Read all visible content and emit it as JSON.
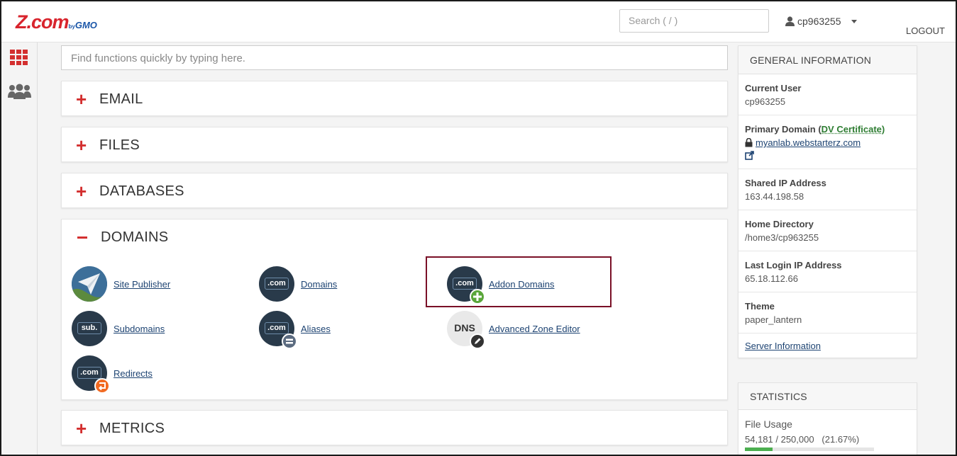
{
  "brand": {
    "logo_text": "Z.com",
    "logo_by": "by",
    "logo_gmo": "GMO",
    "accent": "#d8242d"
  },
  "header": {
    "search_placeholder": "Search ( / )",
    "username": "cp963255",
    "logout_label": "LOGOUT"
  },
  "quickfind": {
    "placeholder": "Find functions quickly by typing here."
  },
  "groups": [
    {
      "label": "EMAIL",
      "expanded": false
    },
    {
      "label": "FILES",
      "expanded": false
    },
    {
      "label": "DATABASES",
      "expanded": false
    },
    {
      "label": "DOMAINS",
      "expanded": true
    },
    {
      "label": "METRICS",
      "expanded": false
    }
  ],
  "domains_items": [
    {
      "label": "Site Publisher",
      "icon": "paper-plane-icon"
    },
    {
      "label": "Domains",
      "icon": "dotcom-icon"
    },
    {
      "label": "Addon Domains",
      "icon": "dotcom-add-icon",
      "highlighted": true
    },
    {
      "label": "Subdomains",
      "icon": "sub-icon"
    },
    {
      "label": "Aliases",
      "icon": "dotcom-equals-icon"
    },
    {
      "label": "Advanced Zone Editor",
      "icon": "dns-edit-icon"
    },
    {
      "label": "Redirects",
      "icon": "dotcom-redirect-icon"
    }
  ],
  "icon_text": {
    "dotcom": ".com",
    "sub": "sub.",
    "dns": "DNS"
  },
  "general_info": {
    "title": "GENERAL INFORMATION",
    "current_user_label": "Current User",
    "current_user": "cp963255",
    "primary_domain_label": "Primary Domain (",
    "dv_label": "DV Certificate",
    "primary_domain_close": ")",
    "primary_domain": "myanlab.webstarterz.com",
    "shared_ip_label": "Shared IP Address",
    "shared_ip": "163.44.198.58",
    "home_dir_label": "Home Directory",
    "home_dir": "/home3/cp963255",
    "last_login_label": "Last Login IP Address",
    "last_login_ip": "65.18.112.66",
    "theme_label": "Theme",
    "theme": "paper_lantern",
    "server_info_link": "Server Information"
  },
  "statistics": {
    "title": "STATISTICS",
    "file_usage_label": "File Usage",
    "file_usage_value": "54,181 / 250,000   (21.67%)",
    "file_usage_fraction": 0.2167
  }
}
